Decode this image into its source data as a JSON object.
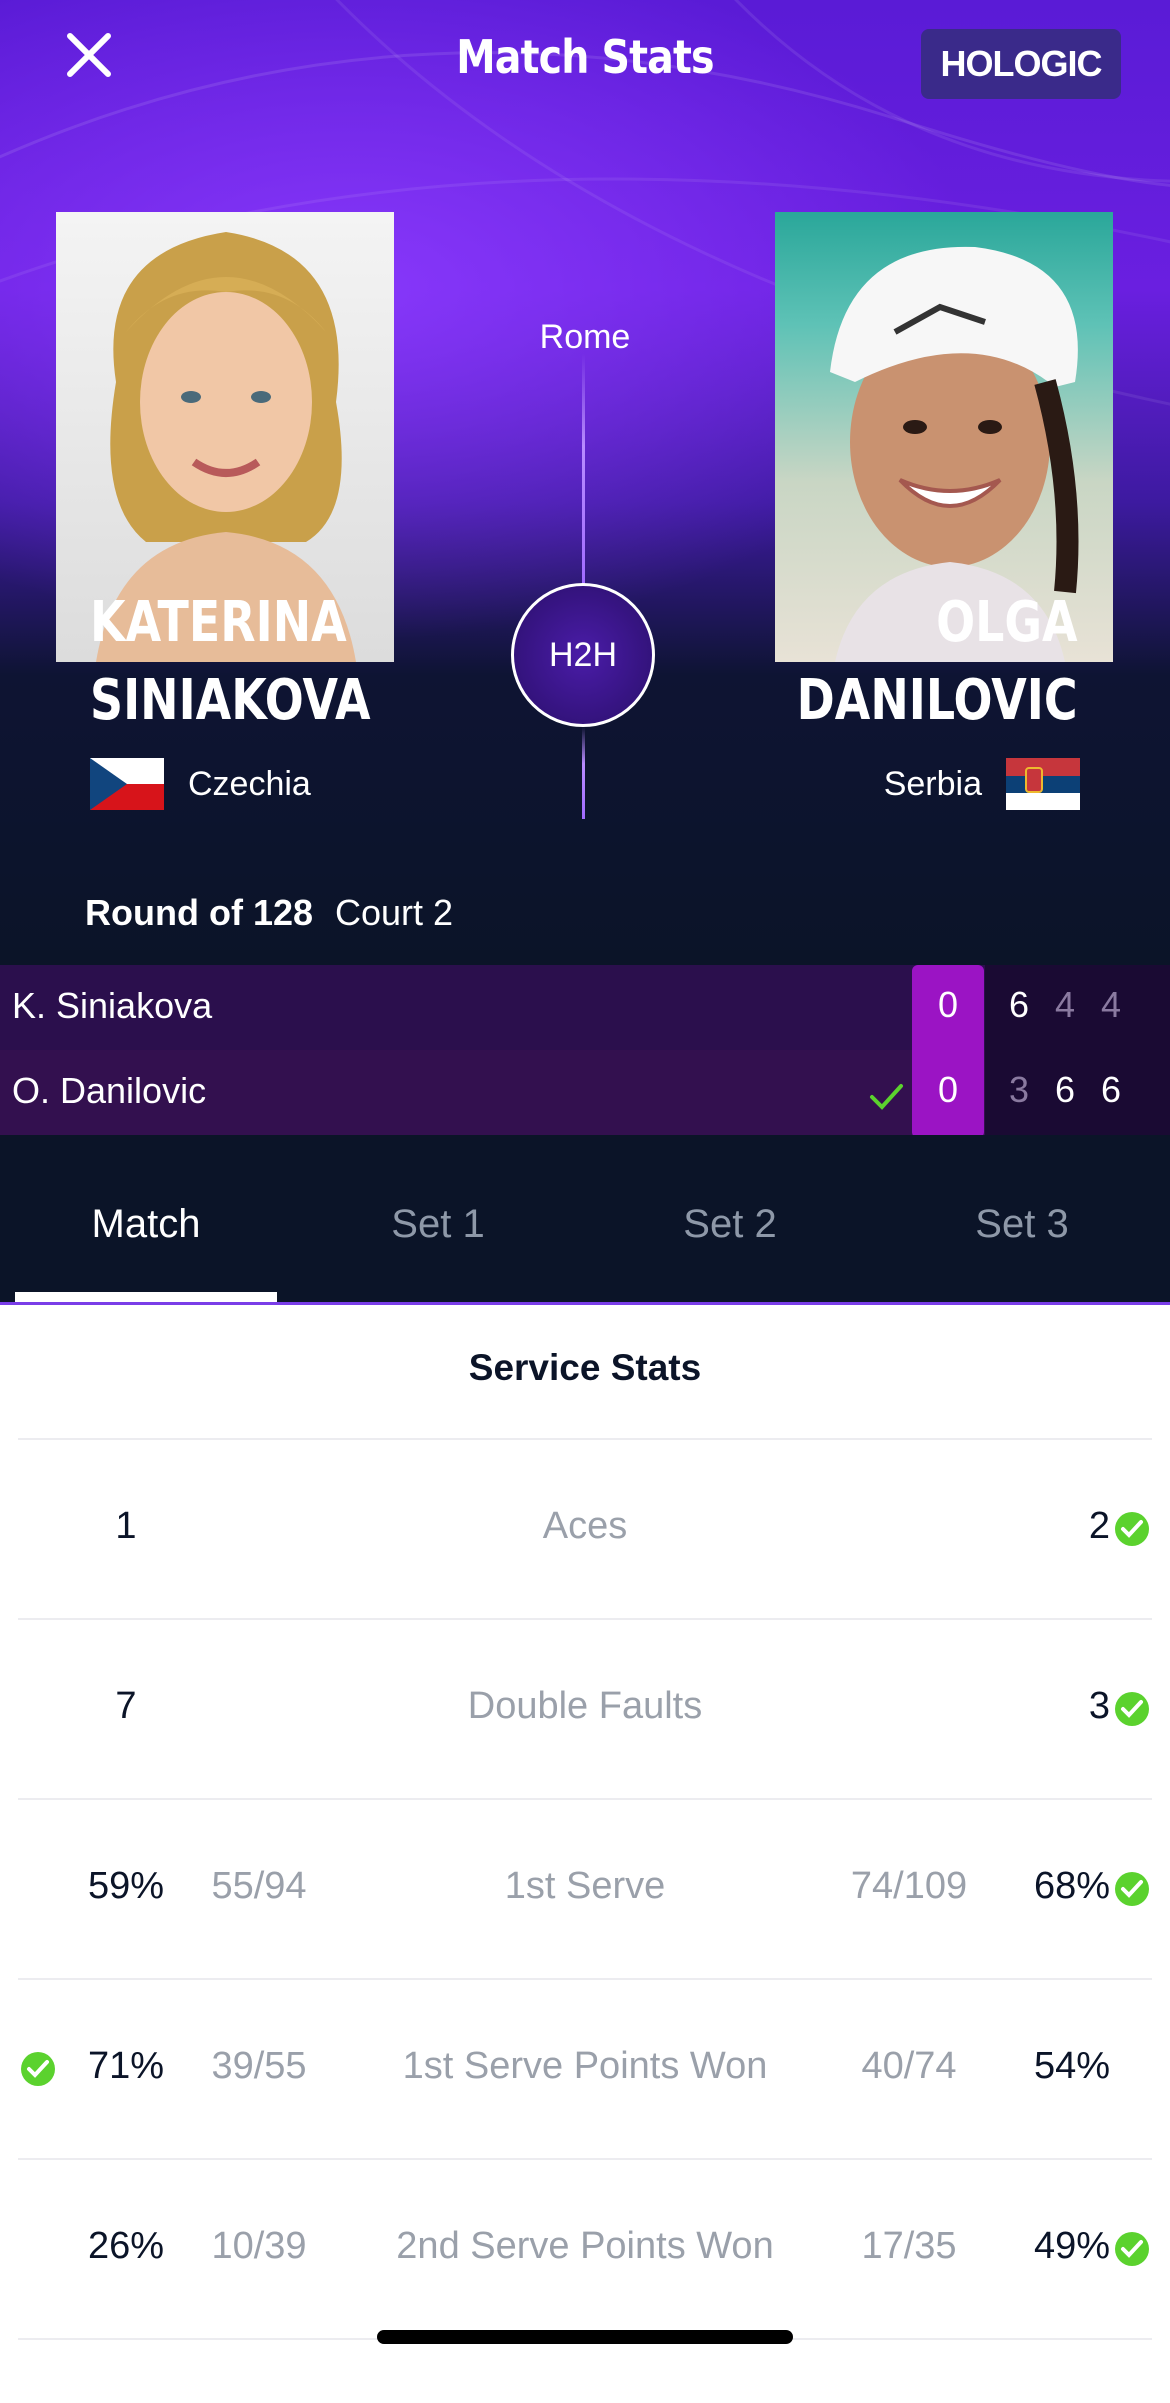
{
  "header": {
    "title": "Match Stats",
    "sponsor": "HOLOGIC"
  },
  "match": {
    "venue": "Rome",
    "h2h_label": "H2H",
    "round": "Round of 128",
    "court": "Court 2"
  },
  "players": [
    {
      "first": "KATERINA",
      "last": "SINIAKOVA",
      "country": "Czechia",
      "short": "K. Siniakova",
      "game": "0",
      "sets": [
        "6",
        "4",
        "4"
      ]
    },
    {
      "first": "OLGA",
      "last": "DANILOVIC",
      "country": "Serbia",
      "short": "O. Danilovic",
      "game": "0",
      "sets": [
        "3",
        "6",
        "6"
      ]
    }
  ],
  "tabs": [
    "Match",
    "Set 1",
    "Set 2",
    "Set 3"
  ],
  "active_tab": "Match",
  "section": "Service Stats",
  "stats": [
    {
      "label": "Aces",
      "left": "1",
      "right": "2",
      "winner": "right"
    },
    {
      "label": "Double Faults",
      "left": "7",
      "right": "3",
      "winner": "right"
    },
    {
      "label": "1st Serve",
      "left": "59%",
      "left_frac": "55/94",
      "right": "68%",
      "right_frac": "74/109",
      "winner": "right"
    },
    {
      "label": "1st Serve Points Won",
      "left": "71%",
      "left_frac": "39/55",
      "right": "54%",
      "right_frac": "40/74",
      "winner": "left"
    },
    {
      "label": "2nd Serve Points Won",
      "left": "26%",
      "left_frac": "10/39",
      "right": "49%",
      "right_frac": "17/35",
      "winner": "right"
    }
  ],
  "colors": {
    "accent_purple": "#9b14c4",
    "win_green": "#5bd22e",
    "navy": "#0b1428"
  }
}
